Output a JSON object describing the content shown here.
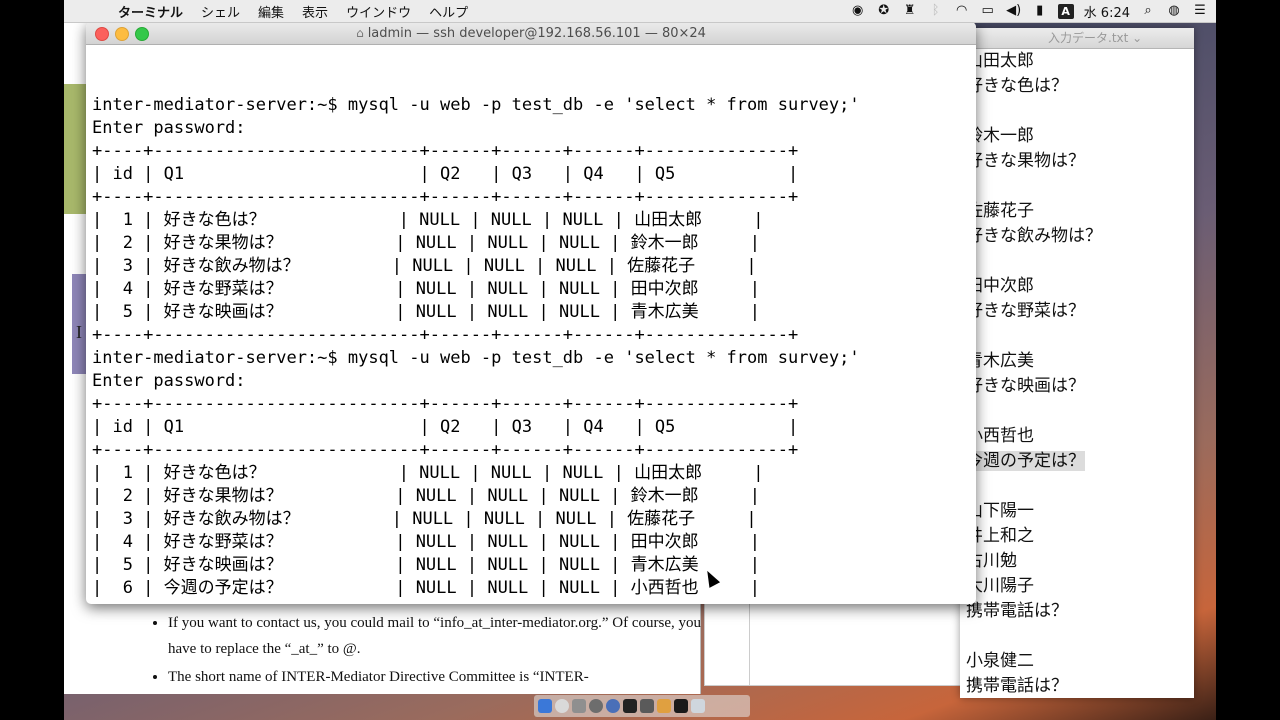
{
  "menubar": {
    "apple_icon": "apple-icon",
    "app_name": "ターミナル",
    "menus": [
      "シェル",
      "編集",
      "表示",
      "ウインドウ",
      "ヘルプ"
    ],
    "ime_indicator": "A",
    "clock": "水 6:24"
  },
  "terminal": {
    "title": "ladmin — ssh developer@192.168.56.101 — 80×24",
    "lines": [
      "inter-mediator-server:~$ mysql -u web -p test_db -e 'select * from survey;'",
      "Enter password:",
      "+----+--------------------------+------+------+------+--------------+",
      "| id | Q1                       | Q2   | Q3   | Q4   | Q5           |",
      "+----+--------------------------+------+------+------+--------------+",
      "|  1 | 好きな色は？             | NULL | NULL | NULL | 山田太郎     |",
      "|  2 | 好きな果物は？           | NULL | NULL | NULL | 鈴木一郎     |",
      "|  3 | 好きな飲み物は？         | NULL | NULL | NULL | 佐藤花子     |",
      "|  4 | 好きな野菜は？           | NULL | NULL | NULL | 田中次郎     |",
      "|  5 | 好きな映画は？           | NULL | NULL | NULL | 青木広美     |",
      "+----+--------------------------+------+------+------+--------------+",
      "inter-mediator-server:~$ mysql -u web -p test_db -e 'select * from survey;'",
      "Enter password:",
      "+----+--------------------------+------+------+------+--------------+",
      "| id | Q1                       | Q2   | Q3   | Q4   | Q5           |",
      "+----+--------------------------+------+------+------+--------------+",
      "|  1 | 好きな色は？             | NULL | NULL | NULL | 山田太郎     |",
      "|  2 | 好きな果物は？           | NULL | NULL | NULL | 鈴木一郎     |",
      "|  3 | 好きな飲み物は？         | NULL | NULL | NULL | 佐藤花子     |",
      "|  4 | 好きな野菜は？           | NULL | NULL | NULL | 田中次郎     |",
      "|  5 | 好きな映画は？           | NULL | NULL | NULL | 青木広美     |",
      "|  6 | 今週の予定は？           | NULL | NULL | NULL | 小西哲也     |",
      "+----+--------------------------+------+------+------+--------------+"
    ],
    "prompt": "inter-mediator-server:~$ "
  },
  "textedit": {
    "title": "入力データ.txt",
    "lines": [
      "山田太郎",
      "好きな色は？",
      "",
      "鈴木一郎",
      "好きな果物は？",
      "",
      "佐藤花子",
      "好きな飲み物は？",
      "",
      "田中次郎",
      "好きな野菜は？",
      "",
      "青木広美",
      "好きな映画は？",
      "",
      "小西哲也",
      "今週の予定は？",
      "",
      "山下陽一",
      "井上和之",
      "古川勉",
      "大川陽子",
      "携帯電話は？",
      "",
      "小泉健二",
      "携帯電話は？"
    ],
    "selected_index": 16
  },
  "document": {
    "left_label": "I",
    "bullets": [
      "If you want to contact us, you could mail to “info_at_inter-mediator.org.” Of course, you have to replace the “_at_” to @.",
      "The short name of INTER-Mediator Directive Committee is “INTER-"
    ]
  }
}
